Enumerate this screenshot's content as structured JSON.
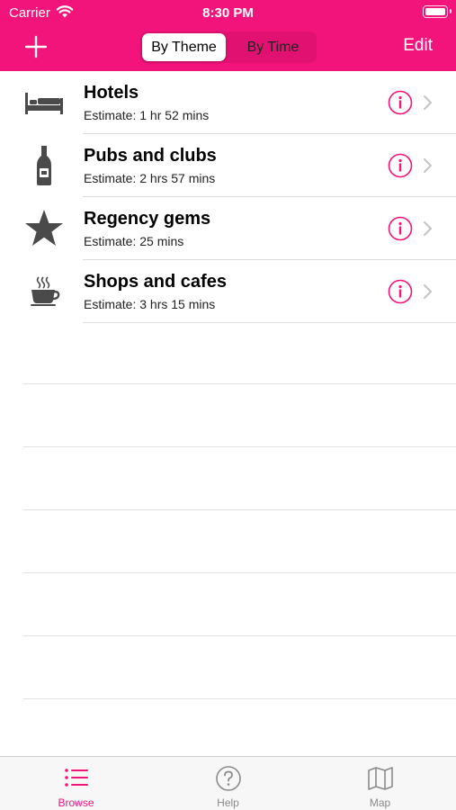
{
  "status_bar": {
    "carrier": "Carrier",
    "time": "8:30 PM"
  },
  "nav": {
    "add_icon": "plus-icon",
    "segments": [
      "By Theme",
      "By Time"
    ],
    "selected_segment": "By Theme",
    "edit_label": "Edit"
  },
  "colors": {
    "accent": "#f2137b",
    "icon_gray": "#4a4a4a"
  },
  "list": {
    "items": [
      {
        "title": "Hotels",
        "estimate": "Estimate: 1 hr 52 mins",
        "icon": "bed-icon"
      },
      {
        "title": "Pubs and clubs",
        "estimate": "Estimate: 2 hrs 57 mins",
        "icon": "bottle-icon"
      },
      {
        "title": "Regency gems",
        "estimate": "Estimate: 25 mins",
        "icon": "star-icon"
      },
      {
        "title": "Shops and cafes",
        "estimate": "Estimate: 3 hrs 15 mins",
        "icon": "coffee-cup-icon"
      }
    ]
  },
  "tabbar": {
    "tabs": [
      {
        "label": "Browse",
        "icon": "list-icon",
        "selected": true
      },
      {
        "label": "Help",
        "icon": "question-circle-icon",
        "selected": false
      },
      {
        "label": "Map",
        "icon": "map-icon",
        "selected": false
      }
    ]
  }
}
